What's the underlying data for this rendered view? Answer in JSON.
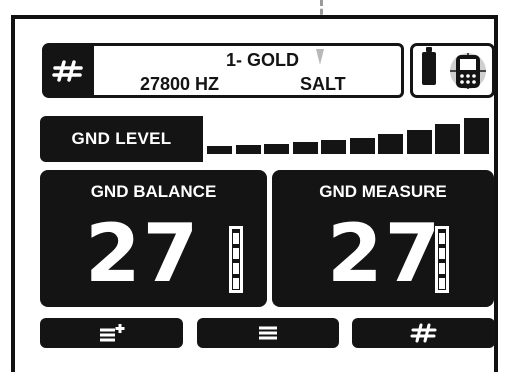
{
  "header": {
    "mode_icon": "hash-icon",
    "program_name": "1- GOLD",
    "frequency": "27800 HZ",
    "ground_type": "SALT",
    "status_icons": [
      "battery-icon",
      "detector-device-icon"
    ]
  },
  "ground_level": {
    "label": "GND LEVEL",
    "bars_total": 10,
    "bars_shown": 10
  },
  "panels": {
    "balance": {
      "title": "GND BALANCE",
      "value": "27"
    },
    "measure": {
      "title": "GND MEASURE",
      "value": "27"
    }
  },
  "softkeys": [
    {
      "icon": "menu-add-icon"
    },
    {
      "icon": "menu-icon"
    },
    {
      "icon": "hash-icon"
    }
  ],
  "colors": {
    "panel": "#141414",
    "text_light": "#ffffff",
    "text_dark": "#141414",
    "pointer": "#9a9a9a"
  }
}
